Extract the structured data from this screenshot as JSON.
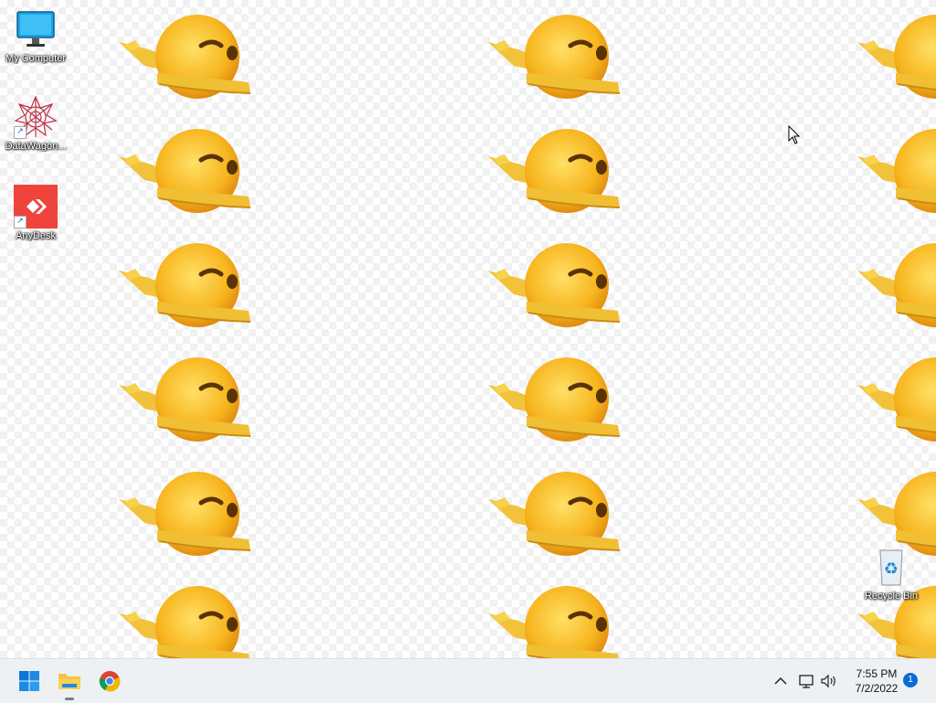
{
  "desktop": {
    "icons": [
      {
        "label": "My Computer",
        "icon": "monitor-icon"
      },
      {
        "label": "DataWagon...",
        "icon": "datawagon-icon"
      },
      {
        "label": "AnyDesk",
        "icon": "anydesk-icon"
      },
      {
        "label": "Recycle Bin",
        "icon": "recycle-bin-icon"
      }
    ],
    "wallpaper": "dabbing-emoji-pattern"
  },
  "taskbar": {
    "pinned": [
      {
        "name": "start",
        "icon": "windows-icon"
      },
      {
        "name": "file-explorer",
        "icon": "folder-icon"
      },
      {
        "name": "chrome",
        "icon": "chrome-icon"
      }
    ],
    "tray": {
      "icons": [
        "chevron-up-icon",
        "network-icon",
        "volume-icon"
      ],
      "time": "7:55 PM",
      "date": "7/2/2022",
      "notifications": "1"
    }
  },
  "colors": {
    "accent": "#0a6bd6",
    "emoji_yellow": "#f7b51e",
    "anydesk_red": "#ef443b"
  }
}
